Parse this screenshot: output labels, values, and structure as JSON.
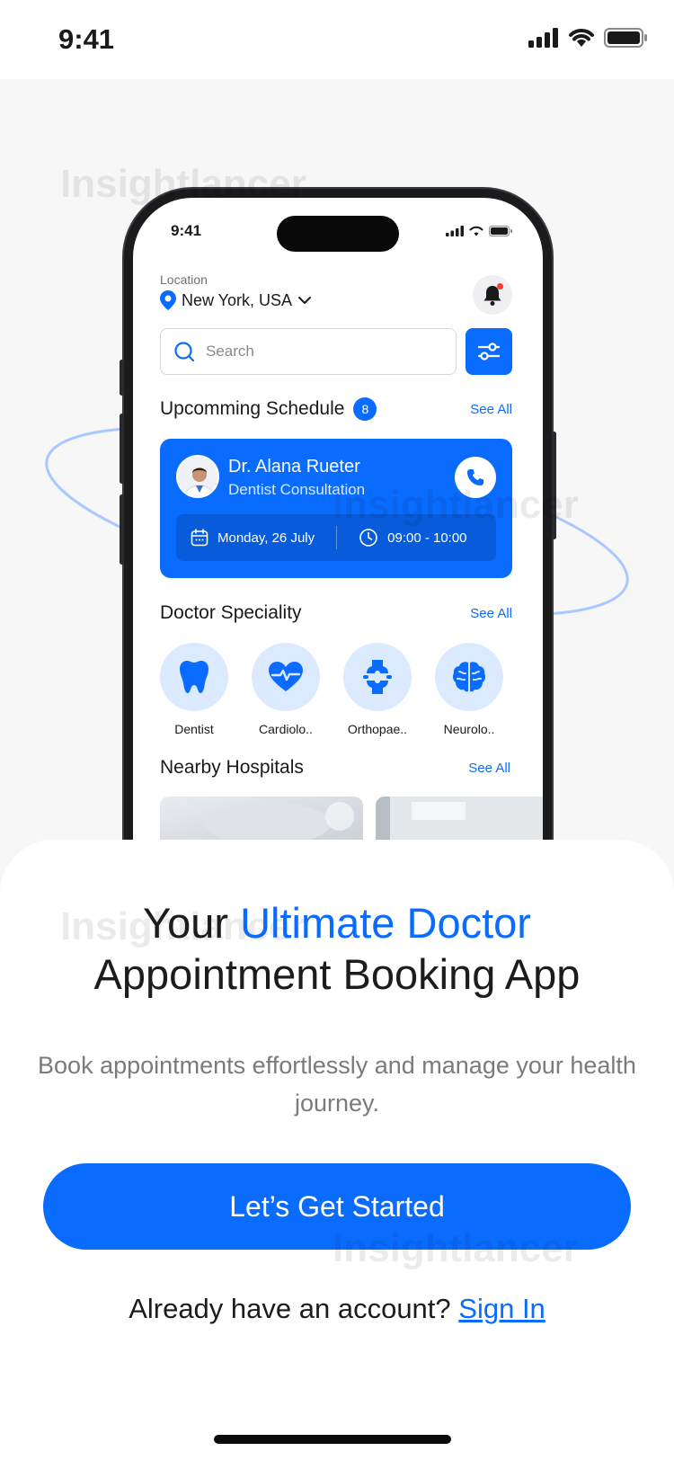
{
  "status_bar": {
    "time": "9:41"
  },
  "watermark": "Insightlancer",
  "phone": {
    "status_time": "9:41",
    "location_label": "Location",
    "location_value": "New York, USA",
    "search_placeholder": "Search",
    "schedule": {
      "title": "Upcomming Schedule",
      "badge": "8",
      "see_all": "See All",
      "doctor_name": "Dr. Alana Rueter",
      "doctor_role": "Dentist Consultation",
      "date": "Monday, 26 July",
      "time": "09:00 - 10:00"
    },
    "speciality": {
      "title": "Doctor Speciality",
      "see_all": "See All",
      "items": [
        {
          "label": "Dentist",
          "icon": "tooth-icon"
        },
        {
          "label": "Cardiolo..",
          "icon": "heart-pulse-icon"
        },
        {
          "label": "Orthopae..",
          "icon": "bone-joint-icon"
        },
        {
          "label": "Neurolo..",
          "icon": "brain-icon"
        }
      ]
    },
    "hospitals": {
      "title": "Nearby Hospitals",
      "see_all": "See All"
    }
  },
  "headline": {
    "part1": "Your ",
    "accent": "Ultimate Doctor",
    "part2": "Appointment Booking App"
  },
  "subtext": "Book appointments effortlessly and manage your health journey.",
  "cta_label": "Let’s Get Started",
  "signin": {
    "prompt": "Already have an account? ",
    "link": "Sign In"
  },
  "colors": {
    "accent": "#0a6cff",
    "light_accent": "#dceaff"
  }
}
